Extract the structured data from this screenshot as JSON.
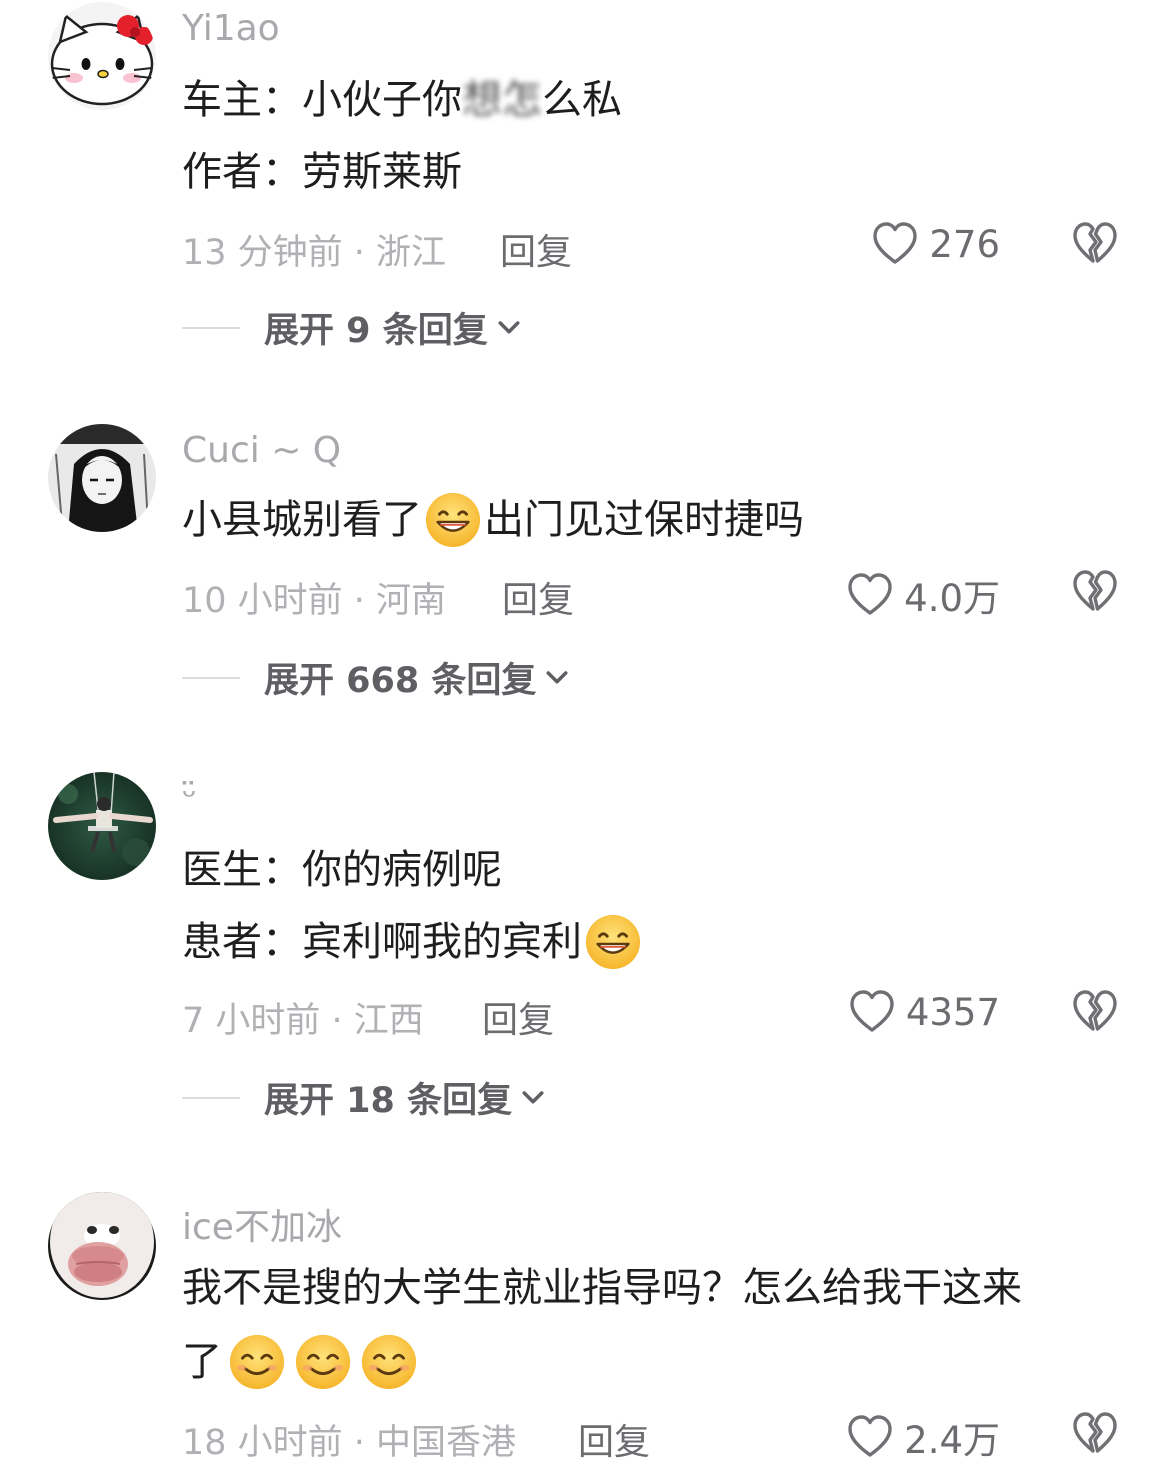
{
  "comments": [
    {
      "username": "Yi1ao",
      "lines": [
        "车主：小伙子你",
        "想怎",
        "么私",
        "作者：劳斯莱斯"
      ],
      "time_location": "13 分钟前 · 浙江",
      "reply_label": "回复",
      "likes": "276",
      "expand_label": "展开 9 条回复"
    },
    {
      "username": "Cuci ~ Q",
      "line1_before": "小县城别看了",
      "line1_after": "出门见过保时捷吗",
      "time_location": "10 小时前 · 河南",
      "reply_label": "回复",
      "likes": "4.0万",
      "expand_label": "展开 668 条回复"
    },
    {
      "username": "ᵕ̈",
      "lines": [
        "医生：你的病例呢",
        "患者：宾利啊我的宾利"
      ],
      "time_location": "7 小时前 · 江西",
      "reply_label": "回复",
      "likes": "4357",
      "expand_label": "展开 18 条回复"
    },
    {
      "username": "ice不加冰",
      "lines": [
        "我不是搜的大学生就业指导吗？怎么给我干这来",
        "了"
      ],
      "time_location": "18 小时前 · 中国香港",
      "reply_label": "回复",
      "likes": "2.4万"
    }
  ],
  "icons": {
    "like": "heart-outline-icon",
    "dislike": "broken-heart-icon",
    "expand": "chevron-down-icon",
    "emoji_grin": "grinning-sweat-emoji",
    "emoji_smile": "smiling-emoji"
  },
  "colors": {
    "username": "#a8a8ad",
    "text": "#1e1e1e",
    "meta": "#b1b1b5",
    "action": "#6c6c70"
  }
}
